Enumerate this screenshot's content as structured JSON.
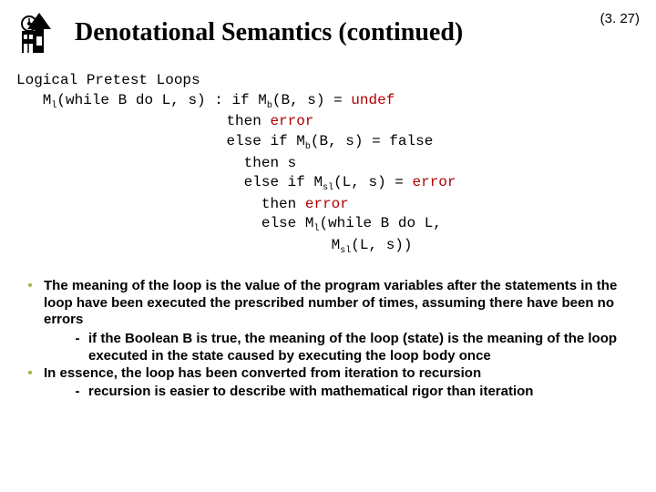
{
  "slide_number": "(3. 27)",
  "title": "Denotational Semantics (continued)",
  "code": {
    "heading": "Logical Pretest Loops",
    "line1_a": "   M",
    "line1_sub1": "l",
    "line1_b": "(while B do L, s) : if M",
    "line1_sub2": "b",
    "line1_c": "(B, s) = ",
    "line1_kw": "undef",
    "line2_a": "                        then ",
    "line2_kw": "error",
    "line3_a": "                        else if M",
    "line3_sub": "b",
    "line3_b": "(B, s) = false",
    "line4": "                          then s",
    "line5_a": "                          else if M",
    "line5_sub": "sl",
    "line5_b": "(L, s) = ",
    "line5_kw": "error",
    "line6_a": "                            then ",
    "line6_kw": "error",
    "line7_a": "                            else M",
    "line7_sub": "l",
    "line7_b": "(while B do L,",
    "line8_a": "                                    M",
    "line8_sub": "sl",
    "line8_b": "(L, s))"
  },
  "bullets": [
    {
      "text": "The meaning of the loop is the value of the program  variables after the statements in the loop have been executed the prescribed number of times, assuming there have been no errors",
      "subs": [
        "if the Boolean B is true, the meaning of the loop (state) is the meaning of the loop executed in the state caused by executing the loop body once"
      ]
    },
    {
      "text": "In essence, the loop has been converted from iteration to recursion",
      "subs": [
        "recursion is easier to describe with mathematical rigor than iteration"
      ]
    }
  ]
}
